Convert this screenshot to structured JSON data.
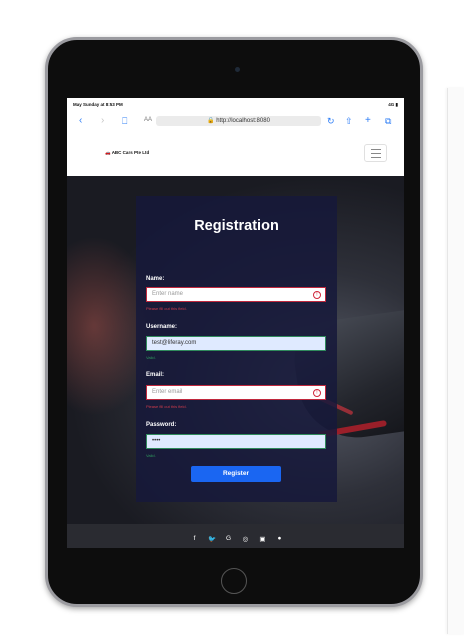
{
  "status": {
    "time": "May Sunday at 8:53 PM",
    "signal": "4G"
  },
  "browser": {
    "reader_label": "AA",
    "url": "http://localhost:8080"
  },
  "brand": "ABC Cars Pte Ltd",
  "form": {
    "title": "Registration",
    "name": {
      "label": "Name:",
      "placeholder": "Enter name",
      "value": "",
      "message": "Please fill out this field."
    },
    "username": {
      "label": "Username:",
      "value": "test@liferay.com",
      "message": "Valid."
    },
    "email": {
      "label": "Email:",
      "placeholder": "Enter email",
      "value": "",
      "message": "Please fill out this field."
    },
    "password": {
      "label": "Password:",
      "value": "••••",
      "message": "Valid."
    },
    "submit_label": "Register"
  },
  "footer": {
    "icons": [
      "facebook-icon",
      "twitter-icon",
      "google-icon",
      "instagram-icon",
      "linkedin-icon",
      "github-icon"
    ]
  },
  "colors": {
    "accent": "#1a66f2",
    "error": "#c0283d",
    "valid": "#2f8a5c"
  }
}
